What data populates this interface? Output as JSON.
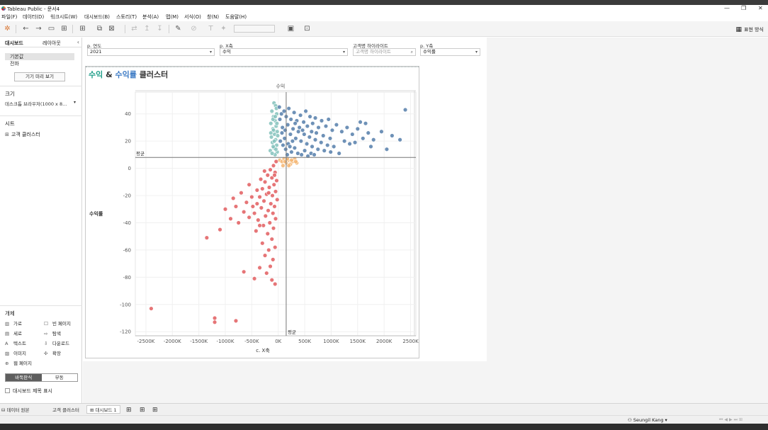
{
  "window": {
    "title": "Tableau Public - 문서4",
    "minimize_glyph": "—",
    "restore_glyph": "❐",
    "close_glyph": "✕"
  },
  "menu": [
    "파일(F)",
    "데이터(D)",
    "워크시트(W)",
    "대시보드(B)",
    "스토리(T)",
    "분석(A)",
    "맵(M)",
    "서식(O)",
    "창(N)",
    "도움말(H)"
  ],
  "toolbar": {
    "present_label": "표현 방식",
    "present_icon": "presentation-icon"
  },
  "left_panel": {
    "tabs": [
      "대시보드",
      "레이아웃"
    ],
    "devices": [
      "기본값",
      "전화"
    ],
    "device_preview_button": "기기 미리 보기",
    "size_title": "크기",
    "size_value": "데스크톱 브라우저(1000 x 8...",
    "sheets_title": "시트",
    "sheets": [
      "고객 클러스터"
    ],
    "objects_title": "개체",
    "objects": [
      {
        "label": "가로",
        "icon": "horizontal-icon"
      },
      {
        "label": "빈 페이지",
        "icon": "blank-icon"
      },
      {
        "label": "세로",
        "icon": "vertical-icon"
      },
      {
        "label": "탐색",
        "icon": "navigation-icon"
      },
      {
        "label": "텍스트",
        "icon": "text-icon"
      },
      {
        "label": "다운로드",
        "icon": "download-icon"
      },
      {
        "label": "이미지",
        "icon": "image-icon"
      },
      {
        "label": "확장",
        "icon": "extension-icon"
      },
      {
        "label": "웹 페이지",
        "icon": "web-page-icon"
      }
    ],
    "layout_toggle": [
      "바둑판식",
      "부동"
    ],
    "show_title_label": "대시보드 제목 표시"
  },
  "params": [
    {
      "label": "p. 연도",
      "value": "2021",
      "type": "dropdown"
    },
    {
      "label": "p. X축",
      "value": "수익",
      "type": "dropdown"
    },
    {
      "label": "고객명 하이라이트",
      "value": "고객명 하이라이트",
      "type": "search"
    },
    {
      "label": "p. Y축",
      "value": "수익률",
      "type": "dropdown"
    }
  ],
  "sheet_title": {
    "part1": "수익",
    "amp": " & ",
    "part2": "수익률",
    "part3": " 클러스터"
  },
  "colors": {
    "teal": "#7fbfba",
    "blue": "#4e79a7",
    "red": "#e15759",
    "orange": "#f4b26b",
    "green_title": "#1f9e89",
    "blue_title": "#3a79c4"
  },
  "chart_data": {
    "type": "scatter",
    "xlabel": "c. X축",
    "ylabel": "수익률",
    "top_label": "수익",
    "avg_label": "평균",
    "x_ticks": [
      "-2500K",
      "-2000K",
      "-1500K",
      "-1000K",
      "-500K",
      "0K",
      "500K",
      "1000K",
      "1500K",
      "2000K",
      "2500K"
    ],
    "y_ticks": [
      "40",
      "20",
      "0",
      "-20",
      "-40",
      "-60",
      "-80",
      "-100",
      "-120"
    ],
    "xlim": [
      -2700000,
      2600000
    ],
    "ylim": [
      -123,
      56
    ],
    "x_avg": 150000,
    "y_avg": 8,
    "series": [
      {
        "color": "#7fbfba",
        "points": [
          [
            -80000,
            48
          ],
          [
            -50000,
            46
          ],
          [
            -120000,
            42
          ],
          [
            -30000,
            40
          ],
          [
            -90000,
            38
          ],
          [
            -60000,
            35
          ],
          [
            -140000,
            33
          ],
          [
            -40000,
            31
          ],
          [
            -100000,
            29
          ],
          [
            -20000,
            27
          ],
          [
            -70000,
            25
          ],
          [
            -130000,
            23
          ],
          [
            -50000,
            21
          ],
          [
            -110000,
            19
          ],
          [
            -30000,
            17
          ],
          [
            -80000,
            15
          ],
          [
            -150000,
            13
          ],
          [
            -20000,
            12
          ],
          [
            -60000,
            10
          ],
          [
            -100000,
            36
          ],
          [
            -35000,
            44
          ],
          [
            -90000,
            28
          ],
          [
            -45000,
            14
          ],
          [
            -115000,
            11
          ],
          [
            -25000,
            33
          ],
          [
            -75000,
            20
          ],
          [
            -140000,
            26
          ],
          [
            -55000,
            38
          ],
          [
            -10000,
            24
          ],
          [
            -95000,
            16
          ]
        ]
      },
      {
        "color": "#4e79a7",
        "points": [
          [
            20000,
            45
          ],
          [
            60000,
            40
          ],
          [
            110000,
            42
          ],
          [
            150000,
            38
          ],
          [
            200000,
            44
          ],
          [
            240000,
            36
          ],
          [
            300000,
            41
          ],
          [
            350000,
            35
          ],
          [
            420000,
            39
          ],
          [
            480000,
            34
          ],
          [
            520000,
            42
          ],
          [
            600000,
            38
          ],
          [
            650000,
            33
          ],
          [
            700000,
            37
          ],
          [
            760000,
            30
          ],
          [
            820000,
            35
          ],
          [
            900000,
            31
          ],
          [
            950000,
            36
          ],
          [
            1020000,
            28
          ],
          [
            1100000,
            32
          ],
          [
            1200000,
            27
          ],
          [
            1300000,
            30
          ],
          [
            1400000,
            25
          ],
          [
            1500000,
            29
          ],
          [
            1600000,
            22
          ],
          [
            1700000,
            26
          ],
          [
            1800000,
            21
          ],
          [
            1950000,
            27
          ],
          [
            2150000,
            24
          ],
          [
            2400000,
            43
          ],
          [
            80000,
            30
          ],
          [
            130000,
            28
          ],
          [
            180000,
            32
          ],
          [
            230000,
            25
          ],
          [
            280000,
            29
          ],
          [
            330000,
            22
          ],
          [
            380000,
            27
          ],
          [
            430000,
            20
          ],
          [
            490000,
            25
          ],
          [
            540000,
            18
          ],
          [
            590000,
            23
          ],
          [
            640000,
            16
          ],
          [
            700000,
            21
          ],
          [
            750000,
            14
          ],
          [
            810000,
            19
          ],
          [
            870000,
            13
          ],
          [
            930000,
            17
          ],
          [
            990000,
            12
          ],
          [
            1050000,
            16
          ],
          [
            1150000,
            11
          ],
          [
            40000,
            20
          ],
          [
            90000,
            17
          ],
          [
            140000,
            14
          ],
          [
            190000,
            18
          ],
          [
            250000,
            12
          ],
          [
            310000,
            15
          ],
          [
            370000,
            11
          ],
          [
            440000,
            10
          ],
          [
            500000,
            13
          ],
          [
            560000,
            9
          ],
          [
            620000,
            11
          ],
          [
            680000,
            10
          ],
          [
            30000,
            36
          ],
          [
            70000,
            26
          ],
          [
            120000,
            22
          ],
          [
            170000,
            10
          ],
          [
            220000,
            16
          ],
          [
            270000,
            20
          ],
          [
            320000,
            33
          ],
          [
            400000,
            30
          ],
          [
            460000,
            28
          ],
          [
            550000,
            31
          ],
          [
            630000,
            27
          ],
          [
            720000,
            26
          ],
          [
            850000,
            24
          ],
          [
            980000,
            22
          ],
          [
            1250000,
            20
          ],
          [
            1350000,
            18
          ],
          [
            1450000,
            19
          ],
          [
            1550000,
            34
          ],
          [
            1650000,
            33
          ],
          [
            1750000,
            16
          ],
          [
            2050000,
            14
          ],
          [
            2300000,
            21
          ]
        ]
      },
      {
        "color": "#f4b26b",
        "points": [
          [
            30000,
            6
          ],
          [
            70000,
            5
          ],
          [
            110000,
            7
          ],
          [
            150000,
            4
          ],
          [
            190000,
            6
          ],
          [
            230000,
            3
          ],
          [
            270000,
            5
          ],
          [
            310000,
            7
          ],
          [
            350000,
            4
          ],
          [
            90000,
            2
          ],
          [
            200000,
            2
          ],
          [
            130000,
            5
          ],
          [
            250000,
            6
          ],
          [
            330000,
            5
          ],
          [
            170000,
            7
          ]
        ]
      },
      {
        "color": "#e15759",
        "points": [
          [
            -40000,
            5
          ],
          [
            -90000,
            2
          ],
          [
            -150000,
            -1
          ],
          [
            -60000,
            -3
          ],
          [
            -200000,
            -5
          ],
          [
            -120000,
            -7
          ],
          [
            -30000,
            -9
          ],
          [
            -250000,
            -10
          ],
          [
            -80000,
            -12
          ],
          [
            -170000,
            -14
          ],
          [
            -300000,
            -15
          ],
          [
            -50000,
            -17
          ],
          [
            -220000,
            -19
          ],
          [
            -110000,
            -20
          ],
          [
            -350000,
            -21
          ],
          [
            -20000,
            -23
          ],
          [
            -270000,
            -24
          ],
          [
            -140000,
            -26
          ],
          [
            -400000,
            -26
          ],
          [
            -70000,
            -28
          ],
          [
            -320000,
            -29
          ],
          [
            -190000,
            -31
          ],
          [
            -100000,
            -33
          ],
          [
            -450000,
            -33
          ],
          [
            -240000,
            -35
          ],
          [
            -50000,
            -37
          ],
          [
            -380000,
            -38
          ],
          [
            -160000,
            -40
          ],
          [
            -280000,
            -42
          ],
          [
            -90000,
            -44
          ],
          [
            -500000,
            -21
          ],
          [
            -600000,
            -25
          ],
          [
            -700000,
            -18
          ],
          [
            -800000,
            -28
          ],
          [
            -650000,
            -32
          ],
          [
            -900000,
            -37
          ],
          [
            -1000000,
            -30
          ],
          [
            -750000,
            -40
          ],
          [
            -550000,
            -36
          ],
          [
            -850000,
            -22
          ],
          [
            -420000,
            -46
          ],
          [
            -200000,
            -48
          ],
          [
            -120000,
            -52
          ],
          [
            -300000,
            -55
          ],
          [
            -60000,
            -58
          ],
          [
            -180000,
            -60
          ],
          [
            -250000,
            -64
          ],
          [
            -100000,
            -67
          ],
          [
            -150000,
            -72
          ],
          [
            -350000,
            -73
          ],
          [
            -220000,
            -77
          ],
          [
            -120000,
            -82
          ],
          [
            -60000,
            -85
          ],
          [
            -450000,
            -81
          ],
          [
            -650000,
            -76
          ],
          [
            -1350000,
            -51
          ],
          [
            -1100000,
            -45
          ],
          [
            -2400000,
            -103
          ],
          [
            -1200000,
            -110
          ],
          [
            -1200000,
            -113
          ],
          [
            -800000,
            -112
          ],
          [
            -400000,
            -16
          ],
          [
            -550000,
            -12
          ],
          [
            -330000,
            -8
          ],
          [
            -480000,
            -28
          ],
          [
            -260000,
            -2
          ],
          [
            -180000,
            -18
          ],
          [
            -350000,
            -42
          ],
          [
            -70000,
            -5
          ]
        ]
      }
    ]
  },
  "bottom_tabs": [
    {
      "label": "데이터 원본",
      "icon": "data-source-icon"
    },
    {
      "label": "고객 클러스터",
      "icon": ""
    },
    {
      "label": "대시보드 1",
      "icon": "dashboard-icon"
    }
  ],
  "status": {
    "user": "Seungil Kang"
  }
}
